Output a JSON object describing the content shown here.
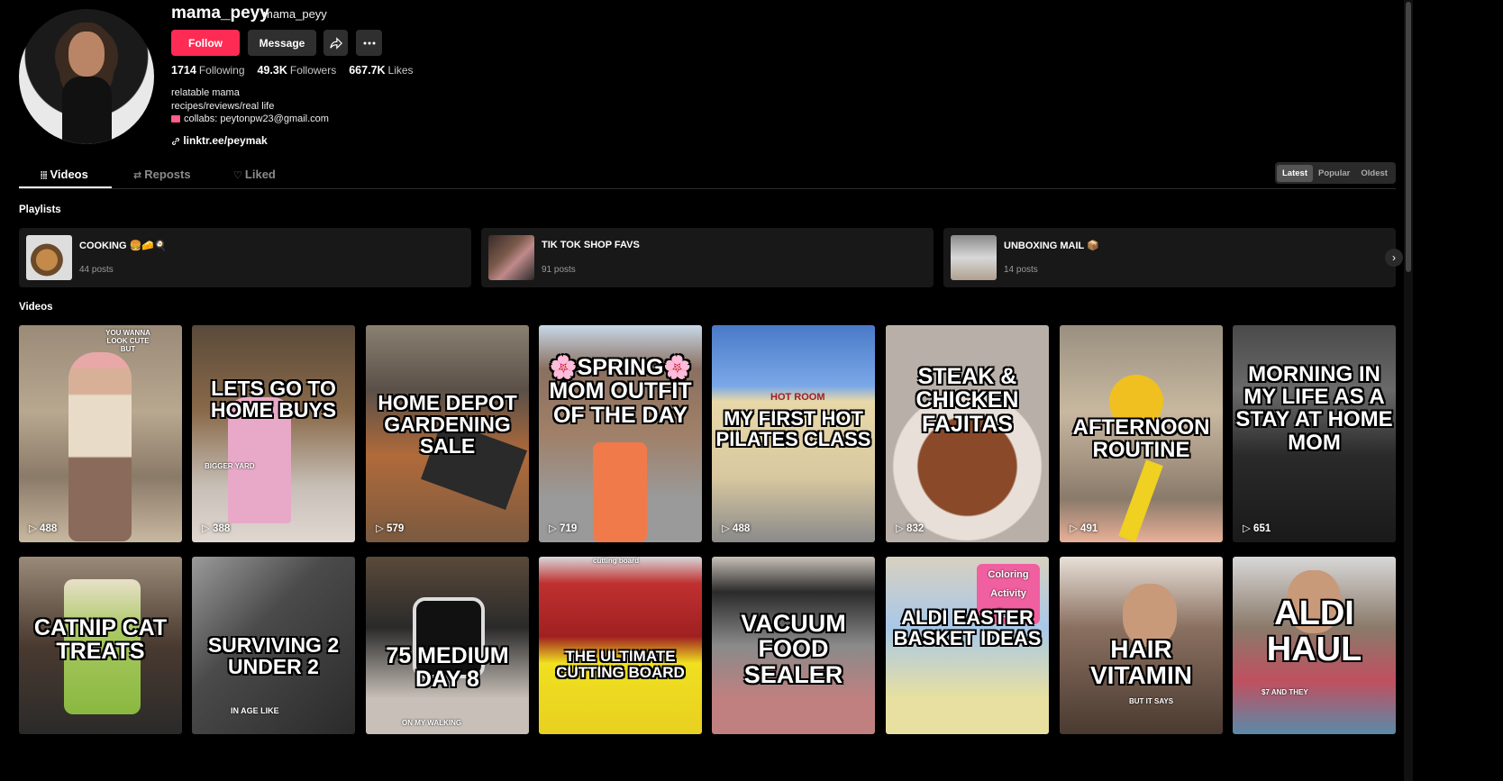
{
  "profile": {
    "username": "mama_peyy",
    "nickname": "mama_peyy",
    "follow_label": "Follow",
    "message_label": "Message",
    "share_icon": "share-icon",
    "more_icon": "more-icon",
    "following_count": "1714",
    "following_label": "Following",
    "followers_count": "49.3K",
    "followers_label": "Followers",
    "likes_count": "667.7K",
    "likes_label": "Likes",
    "bio": [
      "relatable mama",
      "recipes/reviews/real life",
      "collabs: peytonpw23@gmail.com"
    ],
    "link": "linktr.ee/peymak"
  },
  "tabs": {
    "videos": "Videos",
    "reposts": "Reposts",
    "liked": "Liked"
  },
  "sort": {
    "latest": "Latest",
    "popular": "Popular",
    "oldest": "Oldest"
  },
  "sections": {
    "playlists": "Playlists",
    "videos": "Videos"
  },
  "playlists": [
    {
      "title": "COOKING 🍔🧀🍳",
      "count": "44 posts"
    },
    {
      "title": "TIK TOK SHOP FAVS",
      "count": "91 posts"
    },
    {
      "title": "UNBOXING MAIL 📦",
      "count": "14 posts"
    }
  ],
  "videos": [
    {
      "caption": "",
      "small": "YOU WANNA LOOK CUTE BUT",
      "views": "488"
    },
    {
      "caption": "LETS GO TO HOME BUYS",
      "small": "BIGGER YARD",
      "views": "388"
    },
    {
      "caption": "HOME DEPOT GARDENING SALE",
      "small": "",
      "views": "579"
    },
    {
      "caption": "🌸SPRING🌸 MOM OUTFIT OF THE DAY",
      "small": "",
      "views": "719"
    },
    {
      "caption": "MY FIRST HOT PILATES CLASS",
      "small": "HOT ROOM",
      "views": "488"
    },
    {
      "caption": "STEAK & CHICKEN FAJITAS",
      "small": "",
      "views": "832"
    },
    {
      "caption": "AFTERNOON ROUTINE",
      "small": "",
      "views": "491"
    },
    {
      "caption": "MORNING IN MY LIFE AS A STAY AT HOME MOM",
      "small": "",
      "views": "651"
    },
    {
      "caption": "CATNIP CAT TREATS",
      "small": "",
      "views": ""
    },
    {
      "caption": "SURVIVING 2 UNDER 2",
      "small": "IN AGE LIKE",
      "views": ""
    },
    {
      "caption": "75 MEDIUM DAY 8",
      "small": "ON MY WALKING",
      "views": ""
    },
    {
      "caption": "THE ULTIMATE CUTTING BOARD",
      "small": "cutting board",
      "views": ""
    },
    {
      "caption": "VACUUM FOOD SEALER",
      "small": "",
      "views": ""
    },
    {
      "caption": "ALDI EASTER BASKET IDEAS",
      "small": "Coloring Activity Eggs",
      "views": ""
    },
    {
      "caption": "HAIR VITAMIN",
      "small": "BUT IT SAYS",
      "views": ""
    },
    {
      "caption": "ALDI HAUL",
      "small": "$7 AND THEY",
      "views": ""
    }
  ]
}
